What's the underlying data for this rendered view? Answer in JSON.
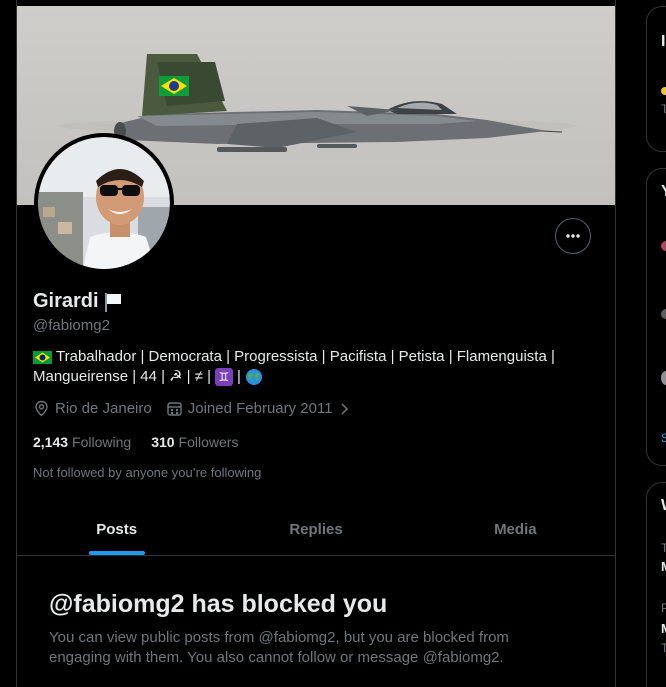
{
  "profile": {
    "display_name": "Girardi",
    "handle": "@fabiomg2",
    "bio_line1_parts": [
      "Trabalhador | Democrata | Progressista | Pacifista | Petista | Flamenguista |"
    ],
    "bio_line2_text": "Mangueirense | 44 | ",
    "bio_line2_mid": "☭ | ≠ | ",
    "bio_gemini": "♊",
    "bio_sep": " | ",
    "location": "Rio de Janeiro",
    "joined": "Joined February 2011",
    "following_count": "2,143",
    "following_label": "Following",
    "followers_count": "310",
    "followers_label": "Followers",
    "not_followed": "Not followed by anyone you’re following"
  },
  "tabs": [
    {
      "label": "Posts",
      "active": true
    },
    {
      "label": "Replies",
      "active": false
    },
    {
      "label": "Media",
      "active": false
    }
  ],
  "blocked": {
    "title": "@fabiomg2 has blocked you",
    "description": "You can view public posts from @fabiomg2, but you are blocked from engaging with them. You also cannot follow or message @fabiomg2."
  },
  "right_sidebar": {
    "card1_heading_fragment": "I",
    "card1_text_fragment": "T",
    "card2_heading_fragment": "Y",
    "card2_link_fragment": "S",
    "card3_heading_fragment": "W",
    "card3_lines": [
      "T",
      "M",
      "P",
      "M",
      "T"
    ]
  },
  "colors": {
    "accent": "#1d9bf0",
    "background": "#000000",
    "border": "#2f3336",
    "muted_text": "#71767b",
    "primary_text": "#e7e9ea"
  },
  "icons": [
    "more-icon",
    "location-icon",
    "calendar-icon",
    "chevron-right-icon",
    "white-flag-icon",
    "brazil-flag-icon",
    "globe-icon"
  ]
}
